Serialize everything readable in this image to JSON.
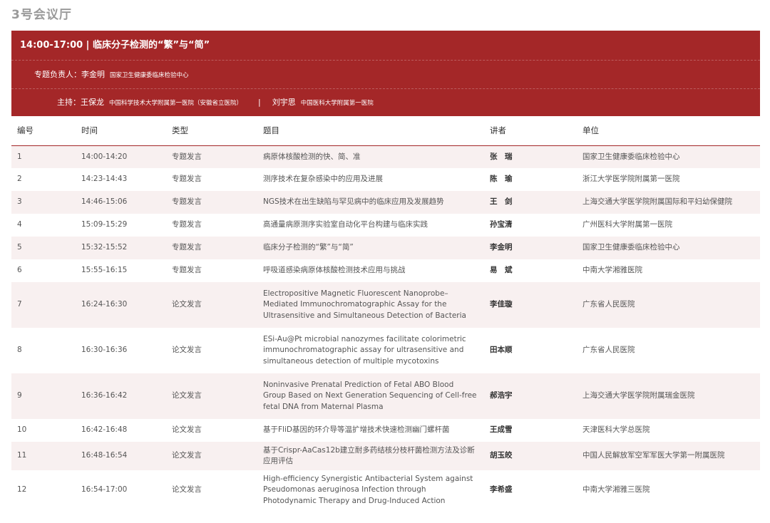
{
  "room_title": "3号会议厅",
  "session": {
    "title": "14:00-17:00 | 临床分子检测的“繁”与“简”",
    "lead_label": "专题负责人：",
    "lead_name": "李金明",
    "lead_org": "国家卫生健康委临床检验中心",
    "host_label": "主持：",
    "host1_name": "王保龙",
    "host1_org": "中国科学技术大学附属第一医院（安徽省立医院）",
    "host_sep": "|",
    "host2_name": "刘宇思",
    "host2_org": "中国医科大学附属第一医院"
  },
  "table": {
    "headers": [
      "编号",
      "时间",
      "类型",
      "题目",
      "讲者",
      "单位"
    ],
    "rows": [
      {
        "no": "1",
        "time": "14:00-14:20",
        "type": "专题发言",
        "topic": "病原体核酸检测的快、简、准",
        "speaker": "张　瑞",
        "org": "国家卫生健康委临床检验中心"
      },
      {
        "no": "2",
        "time": "14:23-14:43",
        "type": "专题发言",
        "topic": "测序技术在复杂感染中的应用及进展",
        "speaker": "陈　瑜",
        "org": "浙江大学医学院附属第一医院"
      },
      {
        "no": "3",
        "time": "14:46-15:06",
        "type": "专题发言",
        "topic": "NGS技术在出生缺陷与罕见病中的临床应用及发展趋势",
        "speaker": "王　剑",
        "org": "上海交通大学医学院附属国际和平妇幼保健院"
      },
      {
        "no": "4",
        "time": "15:09-15:29",
        "type": "专题发言",
        "topic": "高通量病原测序实验室自动化平台构建与临床实践",
        "speaker": "孙宝清",
        "org": "广州医科大学附属第一医院"
      },
      {
        "no": "5",
        "time": "15:32-15:52",
        "type": "专题发言",
        "topic": "临床分子检测的“繁”与“简”",
        "speaker": "李金明",
        "org": "国家卫生健康委临床检验中心"
      },
      {
        "no": "6",
        "time": "15:55-16:15",
        "type": "专题发言",
        "topic": "呼吸道感染病原体核酸检测技术应用与挑战",
        "speaker": "易　斌",
        "org": "中南大学湘雅医院"
      },
      {
        "no": "7",
        "time": "16:24-16:30",
        "type": "论文发言",
        "topic": "Electropositive Magnetic Fluorescent Nanoprobe–Mediated Immunochromatographic Assay for the Ultrasensitive and Simultaneous Detection of Bacteria",
        "speaker": "李佳璇",
        "org": "广东省人民医院"
      },
      {
        "no": "8",
        "time": "16:30-16:36",
        "type": "论文发言",
        "topic": "ESi-Au@Pt microbial nanozymes facilitate colorimetric immunochromatographic assay for ultrasensitive and simultaneous detection of multiple mycotoxins",
        "speaker": "田本顺",
        "org": "广东省人民医院"
      },
      {
        "no": "9",
        "time": "16:36-16:42",
        "type": "论文发言",
        "topic": "Noninvasive Prenatal Prediction of Fetal ABO Blood Group Based on Next Generation Sequencing of Cell-free fetal DNA from Maternal Plasma",
        "speaker": "郝浩宇",
        "org": "上海交通大学医学院附属瑞金医院"
      },
      {
        "no": "10",
        "time": "16:42-16:48",
        "type": "论文发言",
        "topic": "基于FliD基因的环介导等温扩增技术快速检测幽门螺杆菌",
        "speaker": "王成雪",
        "org": "天津医科大学总医院"
      },
      {
        "no": "11",
        "time": "16:48-16:54",
        "type": "论文发言",
        "topic": "基于Crispr-AaCas12b建立耐多药结核分枝杆菌检测方法及诊断应用评估",
        "speaker": "胡玉皎",
        "org": "中国人民解放军空军军医大学第一附属医院"
      },
      {
        "no": "12",
        "time": "16:54-17:00",
        "type": "论文发言",
        "topic": "High-efficiency Synergistic Antibacterial System against Pseudomonas aeruginosa Infection through Photodynamic Therapy and Drug-Induced Action",
        "speaker": "李希盛",
        "org": "中南大学湘雅三医院"
      }
    ]
  },
  "colors": {
    "header_bg": "#a42728",
    "row_alt_bg": "#f8f0f0",
    "title_gray": "#9a9a9a"
  }
}
